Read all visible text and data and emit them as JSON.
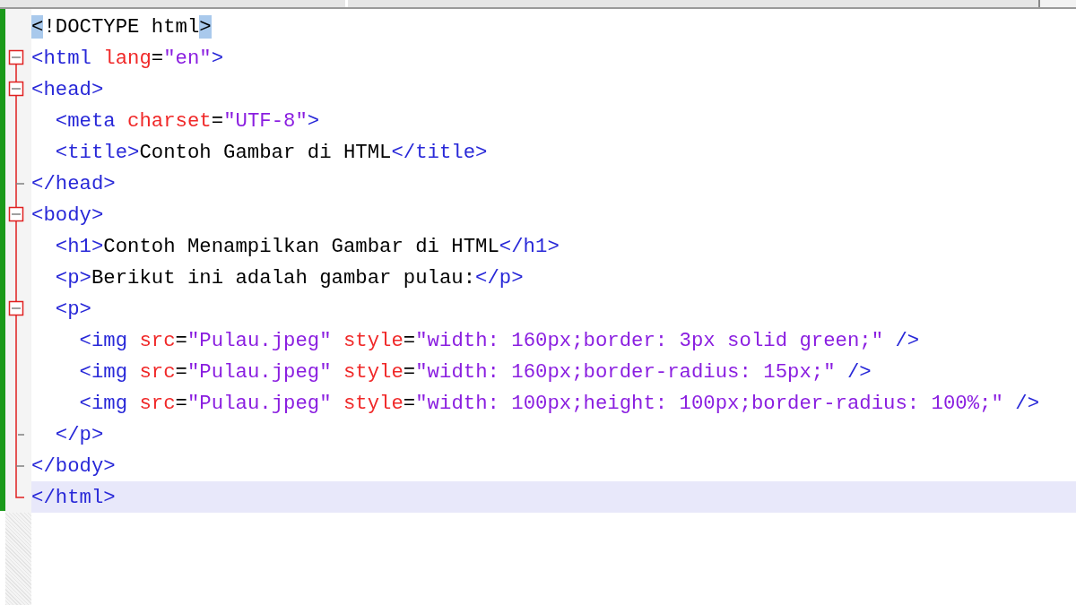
{
  "editor": {
    "lines": [
      {
        "kind": "plain",
        "current": false,
        "tokens": [
          {
            "kind": "match",
            "text": "<"
          },
          {
            "kind": "text",
            "text": "!DOCTYPE html"
          },
          {
            "kind": "match",
            "text": ">"
          }
        ]
      },
      {
        "kind": "open",
        "current": false,
        "tokens": [
          {
            "kind": "tag",
            "text": "<html "
          },
          {
            "kind": "attr",
            "text": "lang"
          },
          {
            "kind": "text",
            "text": "="
          },
          {
            "kind": "value",
            "text": "\"en\""
          },
          {
            "kind": "tag",
            "text": ">"
          }
        ]
      },
      {
        "kind": "open",
        "current": false,
        "tokens": [
          {
            "kind": "tag",
            "text": "<head>"
          }
        ]
      },
      {
        "kind": "line",
        "current": false,
        "tokens": [
          {
            "kind": "tag",
            "text": "  <meta "
          },
          {
            "kind": "attr",
            "text": "charset"
          },
          {
            "kind": "text",
            "text": "="
          },
          {
            "kind": "value",
            "text": "\"UTF-8\""
          },
          {
            "kind": "tag",
            "text": ">"
          }
        ]
      },
      {
        "kind": "line",
        "current": false,
        "tokens": [
          {
            "kind": "tag",
            "text": "  <title>"
          },
          {
            "kind": "text",
            "text": "Contoh Gambar di HTML"
          },
          {
            "kind": "tag",
            "text": "</title>"
          }
        ]
      },
      {
        "kind": "end",
        "current": false,
        "tokens": [
          {
            "kind": "tag",
            "text": "</head>"
          }
        ]
      },
      {
        "kind": "open",
        "current": false,
        "tokens": [
          {
            "kind": "tag",
            "text": "<body>"
          }
        ]
      },
      {
        "kind": "line",
        "current": false,
        "tokens": [
          {
            "kind": "tag",
            "text": "  <h1>"
          },
          {
            "kind": "text",
            "text": "Contoh Menampilkan Gambar di HTML"
          },
          {
            "kind": "tag",
            "text": "</h1>"
          }
        ]
      },
      {
        "kind": "line",
        "current": false,
        "tokens": [
          {
            "kind": "tag",
            "text": "  <p>"
          },
          {
            "kind": "text",
            "text": "Berikut ini adalah gambar pulau:"
          },
          {
            "kind": "tag",
            "text": "</p>"
          }
        ]
      },
      {
        "kind": "open",
        "current": false,
        "tokens": [
          {
            "kind": "tag",
            "text": "  <p>"
          }
        ]
      },
      {
        "kind": "line",
        "current": false,
        "tokens": [
          {
            "kind": "tag",
            "text": "    <img "
          },
          {
            "kind": "attr",
            "text": "src"
          },
          {
            "kind": "text",
            "text": "="
          },
          {
            "kind": "value",
            "text": "\"Pulau.jpeg\" "
          },
          {
            "kind": "attr",
            "text": "style"
          },
          {
            "kind": "text",
            "text": "="
          },
          {
            "kind": "value",
            "text": "\"width: 160px;border: 3px solid green;\" "
          },
          {
            "kind": "tag",
            "text": "/>"
          }
        ]
      },
      {
        "kind": "line",
        "current": false,
        "tokens": [
          {
            "kind": "tag",
            "text": "    <img "
          },
          {
            "kind": "attr",
            "text": "src"
          },
          {
            "kind": "text",
            "text": "="
          },
          {
            "kind": "value",
            "text": "\"Pulau.jpeg\" "
          },
          {
            "kind": "attr",
            "text": "style"
          },
          {
            "kind": "text",
            "text": "="
          },
          {
            "kind": "value",
            "text": "\"width: 160px;border-radius: 15px;\" "
          },
          {
            "kind": "tag",
            "text": "/>"
          }
        ]
      },
      {
        "kind": "line",
        "current": false,
        "tokens": [
          {
            "kind": "tag",
            "text": "    <img "
          },
          {
            "kind": "attr",
            "text": "src"
          },
          {
            "kind": "text",
            "text": "="
          },
          {
            "kind": "value",
            "text": "\"Pulau.jpeg\" "
          },
          {
            "kind": "attr",
            "text": "style"
          },
          {
            "kind": "text",
            "text": "="
          },
          {
            "kind": "value",
            "text": "\"width: 100px;height: 100px;border-radius: 100%;\" "
          },
          {
            "kind": "tag",
            "text": "/>"
          }
        ]
      },
      {
        "kind": "tick",
        "current": false,
        "tokens": [
          {
            "kind": "tag",
            "text": "  </p>"
          }
        ]
      },
      {
        "kind": "end",
        "current": false,
        "tokens": [
          {
            "kind": "tag",
            "text": "</body>"
          }
        ]
      },
      {
        "kind": "last",
        "current": true,
        "tokens": [
          {
            "kind": "tag",
            "text": "</html>"
          }
        ]
      }
    ]
  }
}
